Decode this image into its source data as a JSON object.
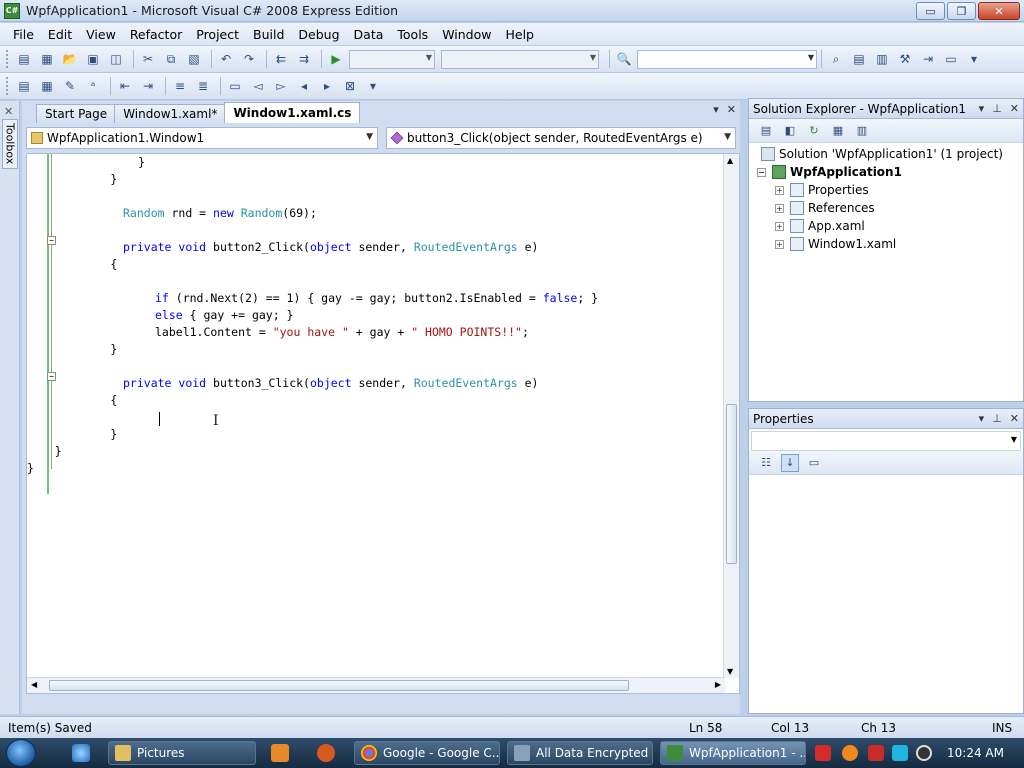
{
  "window": {
    "title": "WpfApplication1 - Microsoft Visual C# 2008 Express Edition",
    "icon_text": "C#",
    "min_glyph": "▭",
    "max_glyph": "❐",
    "close_glyph": "✕"
  },
  "menu": [
    "File",
    "Edit",
    "View",
    "Refactor",
    "Project",
    "Build",
    "Debug",
    "Data",
    "Tools",
    "Window",
    "Help"
  ],
  "toolbox": {
    "label": "Toolbox",
    "close_glyph": "✕"
  },
  "tabs": [
    {
      "label": "Start Page",
      "active": false
    },
    {
      "label": "Window1.xaml*",
      "active": false
    },
    {
      "label": "Window1.xaml.cs",
      "active": true
    }
  ],
  "tab_actions": {
    "dropdown_glyph": "▾",
    "close_glyph": "✕"
  },
  "navigation": {
    "class_combo": "WpfApplication1.Window1",
    "member_combo": "button3_Click(object sender, RoutedEventArgs e)"
  },
  "code": {
    "l1": "            }",
    "l2": "        }",
    "l3": {
      "type1": "Random",
      "mid": " rnd = ",
      "kw": "new",
      "sp": " ",
      "type2": "Random",
      "rest": "(69);"
    },
    "l4": {
      "kw1": "private",
      "s1": " ",
      "kw2": "void",
      "name": " button2_Click(",
      "kw3": "object",
      "s2": " sender, ",
      "type": "RoutedEventArgs",
      "end": " e)"
    },
    "l5": "        {",
    "l6": {
      "kw": "if",
      "a": " (rnd.Next(2) == 1) { gay -= gay; button2.IsEnabled = ",
      "kw2": "false",
      "b": "; }"
    },
    "l7": {
      "kw": "else",
      "a": " { gay += gay; }"
    },
    "l8": {
      "a": "label1.Content = ",
      "s1": "\"you have \"",
      "b": " + gay + ",
      "s2": "\" HOMO POINTS!!\"",
      "c": ";"
    },
    "l9": "        }",
    "l10": {
      "kw1": "private",
      "s1": " ",
      "kw2": "void",
      "name": " button3_Click(",
      "kw3": "object",
      "s2": " sender, ",
      "type": "RoutedEventArgs",
      "end": " e)"
    },
    "l11": "        {",
    "l12": "        }",
    "l13": "    }",
    "l14": "}",
    "ibeam": "I"
  },
  "solution_explorer": {
    "title": "Solution Explorer - WpfApplication1",
    "solution": "Solution 'WpfApplication1' (1 project)",
    "project": "WpfApplication1",
    "items": [
      "Properties",
      "References",
      "App.xaml",
      "Window1.xaml"
    ]
  },
  "properties": {
    "title": "Properties"
  },
  "panel_actions": {
    "dropdown_glyph": "▾",
    "pin_glyph": "⊥",
    "close_glyph": "✕"
  },
  "status": {
    "message": "Item(s) Saved",
    "ln": "Ln 58",
    "col": "Col 13",
    "ch": "Ch 13",
    "mode": "INS"
  },
  "taskbar": {
    "tasks": [
      "Pictures",
      "Google - Google C...",
      "All Data Encrypted",
      "WpfApplication1 - ..."
    ],
    "clock": "10:24 AM"
  }
}
